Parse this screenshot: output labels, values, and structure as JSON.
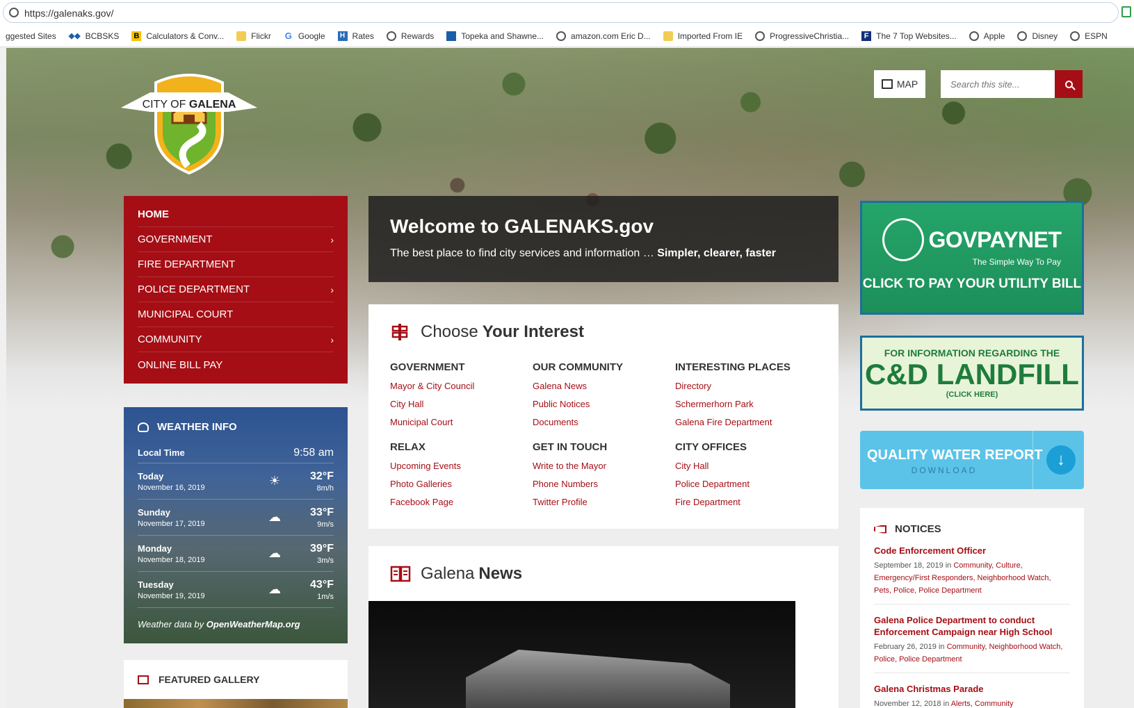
{
  "browser": {
    "url": "https://galenaks.gov/",
    "bookmarks": [
      {
        "label": "ggested Sites",
        "icon": "none"
      },
      {
        "label": "BCBSKS",
        "icon": "bcbs-icon"
      },
      {
        "label": "Calculators & Conv...",
        "icon": "b-icon"
      },
      {
        "label": "Flickr",
        "icon": "folder-icon"
      },
      {
        "label": "Google",
        "icon": "google-icon"
      },
      {
        "label": "Rates",
        "icon": "h-icon"
      },
      {
        "label": "Rewards",
        "icon": "globe-icon"
      },
      {
        "label": "Topeka and Shawne...",
        "icon": "arrow-icon"
      },
      {
        "label": "amazon.com Eric D...",
        "icon": "globe-icon"
      },
      {
        "label": "Imported From IE",
        "icon": "folder-icon"
      },
      {
        "label": "ProgressiveChristia...",
        "icon": "globe-icon"
      },
      {
        "label": "The 7 Top Websites...",
        "icon": "f-icon"
      },
      {
        "label": "Apple",
        "icon": "globe-icon"
      },
      {
        "label": "Disney",
        "icon": "globe-icon"
      },
      {
        "label": "ESPN",
        "icon": "globe-icon"
      }
    ]
  },
  "header": {
    "logo_line1": "CITY OF",
    "logo_line2": "GALENA",
    "map_label": "MAP",
    "search_placeholder": "Search this site..."
  },
  "nav": {
    "items": [
      {
        "label": "HOME",
        "has_sub": false
      },
      {
        "label": "GOVERNMENT",
        "has_sub": true
      },
      {
        "label": "FIRE DEPARTMENT",
        "has_sub": false
      },
      {
        "label": "POLICE DEPARTMENT",
        "has_sub": true
      },
      {
        "label": "MUNICIPAL COURT",
        "has_sub": false
      },
      {
        "label": "COMMUNITY",
        "has_sub": true
      },
      {
        "label": "ONLINE BILL PAY",
        "has_sub": false
      }
    ],
    "chevron": "›"
  },
  "weather": {
    "title": "WEATHER INFO",
    "local_time_label": "Local Time",
    "local_time": "9:58 am",
    "days": [
      {
        "day": "Today",
        "date": "November 16, 2019",
        "icon": "sun-icon",
        "glyph": "☀",
        "temp": "32°F",
        "wind": "8m/h"
      },
      {
        "day": "Sunday",
        "date": "November 17, 2019",
        "icon": "cloud-icon",
        "glyph": "☁",
        "temp": "33°F",
        "wind": "9m/s"
      },
      {
        "day": "Monday",
        "date": "November 18, 2019",
        "icon": "cloud-icon",
        "glyph": "☁",
        "temp": "39°F",
        "wind": "3m/s"
      },
      {
        "day": "Tuesday",
        "date": "November 19, 2019",
        "icon": "cloud-icon",
        "glyph": "☁",
        "temp": "43°F",
        "wind": "1m/s"
      }
    ],
    "footer_prefix": "Weather data by ",
    "footer_source": "OpenWeatherMap.org"
  },
  "gallery": {
    "title": "FEATURED GALLERY"
  },
  "welcome": {
    "title": "Welcome to GALENAKS.gov",
    "subtitle_plain": "The best place to find city services and information … ",
    "subtitle_bold": "Simpler, clearer, faster"
  },
  "interest": {
    "title_light": "Choose",
    "title_bold": "Your Interest",
    "columns": [
      {
        "heading": "GOVERNMENT",
        "links": [
          "Mayor & City Council",
          "City Hall",
          "Municipal Court"
        ]
      },
      {
        "heading": "OUR COMMUNITY",
        "links": [
          "Galena News",
          "Public Notices",
          "Documents"
        ]
      },
      {
        "heading": "INTERESTING PLACES",
        "links": [
          "Directory",
          "Schermerhorn Park",
          "Galena Fire Department"
        ]
      },
      {
        "heading": "RELAX",
        "links": [
          "Upcoming Events",
          "Photo Galleries",
          "Facebook Page"
        ]
      },
      {
        "heading": "GET IN TOUCH",
        "links": [
          "Write to the Mayor",
          "Phone Numbers",
          "Twitter Profile"
        ]
      },
      {
        "heading": "CITY OFFICES",
        "links": [
          "City Hall",
          "Police Department",
          "Fire Department"
        ]
      }
    ]
  },
  "news": {
    "title_light": "Galena",
    "title_bold": "News"
  },
  "govpay": {
    "name": "GOVPAYNET",
    "tagline": "The Simple Way To Pay",
    "cta": "CLICK TO PAY YOUR UTILITY BILL"
  },
  "landfill": {
    "line1": "FOR INFORMATION REGARDING THE",
    "line2": "C&D LANDFILL",
    "line3": "(CLICK HERE)"
  },
  "water": {
    "title": "QUALITY WATER REPORT",
    "sub": "DOWNLOAD"
  },
  "notices": {
    "title": "NOTICES",
    "items": [
      {
        "title": "Code Enforcement Officer",
        "date": "September 18, 2019 in ",
        "cats": "Community, Culture, Emergency/First Responders, Neighborhood Watch, Pets, Police, Police Department"
      },
      {
        "title": "Galena Police Department to conduct Enforcement Campaign near High School",
        "date": "February 26, 2019 in ",
        "cats": "Community, Neighborhood Watch, Police, Police Department"
      },
      {
        "title": "Galena Christmas Parade",
        "date": "November 12, 2018 in ",
        "cats": "Alerts, Community"
      }
    ]
  },
  "colors": {
    "brand_red": "#a50e15",
    "govpay_green": "#25a56a",
    "landfill_green": "#1e7c3c",
    "water_blue": "#5bc3e8"
  }
}
